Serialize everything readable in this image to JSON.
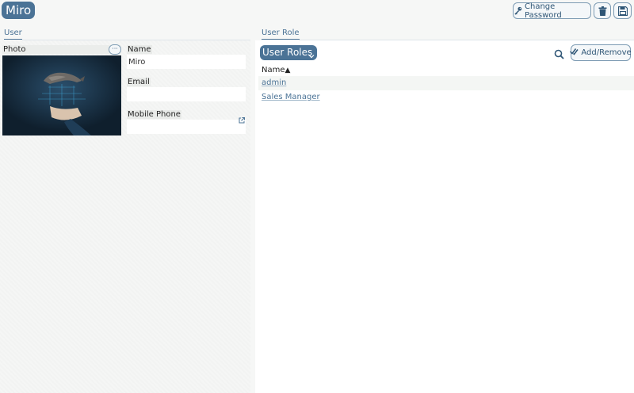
{
  "header": {
    "title": "Miro",
    "change_password_label": "Change Password"
  },
  "left_section": {
    "tab_label": "User",
    "photo_label": "Photo",
    "photo_more": "···",
    "name_label": "Name",
    "name_value": "Miro",
    "email_label": "Email",
    "email_value": "",
    "mobile_label": "Mobile Phone",
    "mobile_value": ""
  },
  "right_section": {
    "tab_label": "User Role",
    "roles_button": "User Roles",
    "add_remove_label": "Add/Remove",
    "column_header": "Name",
    "sort_indicator": "▲",
    "roles": [
      "admin",
      "Sales Manager"
    ]
  },
  "colors": {
    "accent": "#4b7396",
    "button_border": "#7d9bb3",
    "link": "#4b7396"
  }
}
